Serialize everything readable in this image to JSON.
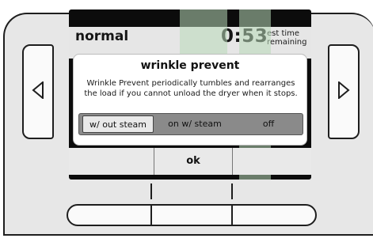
{
  "header": {
    "mode": "normal",
    "time": "0:53",
    "est_line1": "est time",
    "est_line2": "remaining"
  },
  "dialog": {
    "title": "wrinkle prevent",
    "description": "Wrinkle Prevent periodically tumbles and rearranges the load if you cannot unload the dryer when it stops.",
    "options": [
      "w/ out steam",
      "on w/ steam",
      "off"
    ],
    "selected": "w/ out steam"
  },
  "footer": {
    "ok_label": "ok"
  },
  "icons": {
    "left": "left-arrow-icon",
    "right": "right-arrow-icon"
  },
  "colors": {
    "watermark": "#b8d9b8",
    "screen": "#0c0c0c"
  }
}
